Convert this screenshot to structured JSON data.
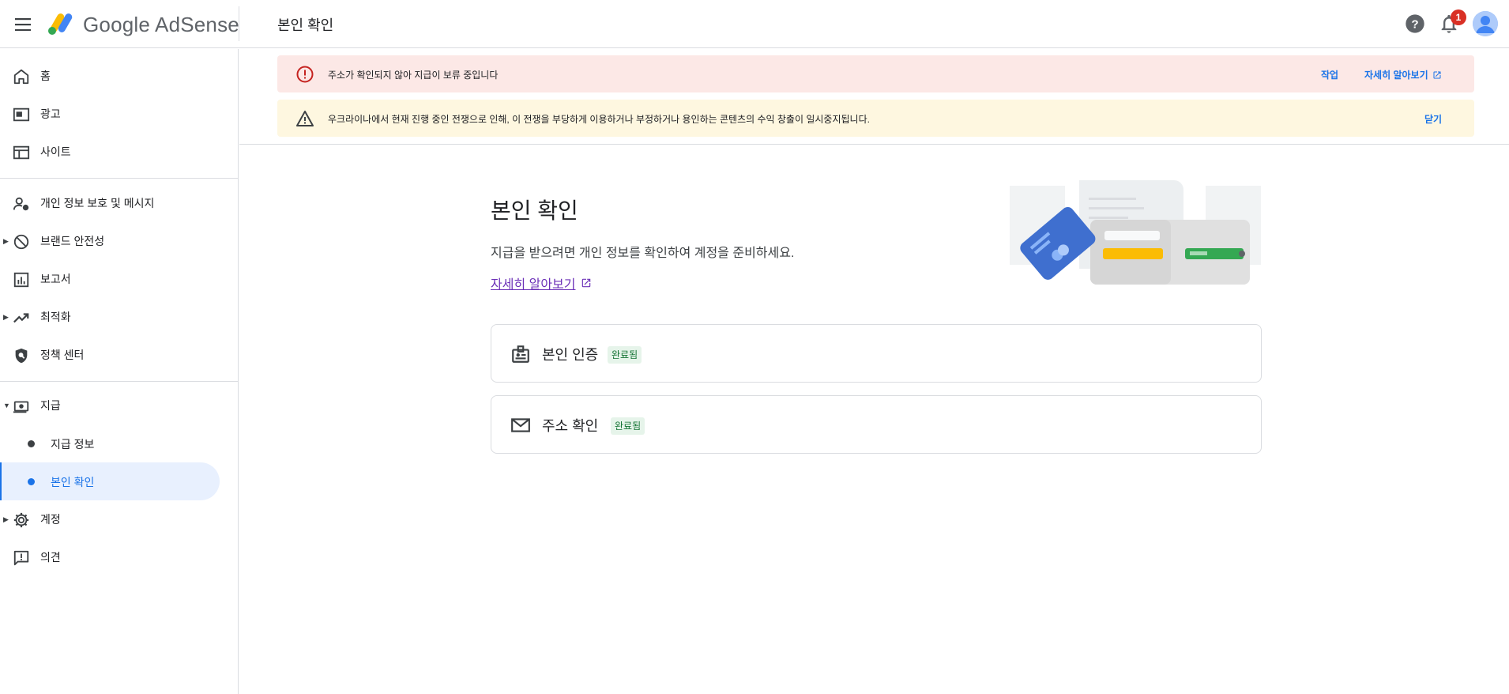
{
  "header": {
    "brand": "Google AdSense",
    "page_title": "본인 확인",
    "notification_count": "1"
  },
  "sidebar": {
    "items": [
      {
        "label": "홈",
        "icon": "home-icon"
      },
      {
        "label": "광고",
        "icon": "ads-icon"
      },
      {
        "label": "사이트",
        "icon": "sites-icon"
      },
      {
        "label": "개인 정보 보호 및 메시지",
        "icon": "privacy-icon"
      },
      {
        "label": "브랜드 안전성",
        "icon": "block-icon"
      },
      {
        "label": "보고서",
        "icon": "reports-icon"
      },
      {
        "label": "최적화",
        "icon": "trending-icon"
      },
      {
        "label": "정책 센터",
        "icon": "policy-icon"
      },
      {
        "label": "지급",
        "icon": "payments-icon"
      },
      {
        "label": "계정",
        "icon": "gear-icon"
      },
      {
        "label": "의견",
        "icon": "feedback-icon"
      }
    ],
    "payments_sub": [
      {
        "label": "지급 정보"
      },
      {
        "label": "본인 확인"
      }
    ]
  },
  "banners": {
    "error": {
      "text": "주소가 확인되지 않아 지급이 보류 중입니다",
      "action1": "작업",
      "action2": "자세히 알아보기"
    },
    "warning": {
      "text": "우크라이나에서 현재 진행 중인 전쟁으로 인해, 이 전쟁을 부당하게 이용하거나 부정하거나 용인하는 콘텐츠의 수익 창출이 일시중지됩니다.",
      "action": "닫기"
    }
  },
  "main": {
    "title": "본인 확인",
    "description": "지급을 받으려면 개인 정보를 확인하여 계정을 준비하세요.",
    "learn_more": "자세히 알아보기",
    "cards": [
      {
        "label": "본인 인증",
        "status": "완료됨",
        "icon": "id-badge-icon"
      },
      {
        "label": "주소 확인",
        "status": "완료됨",
        "icon": "mail-icon"
      }
    ]
  },
  "colors": {
    "accent": "#1a73e8",
    "error_bg": "#fce8e6",
    "warning_bg": "#fef7e0",
    "success": "#137333"
  }
}
